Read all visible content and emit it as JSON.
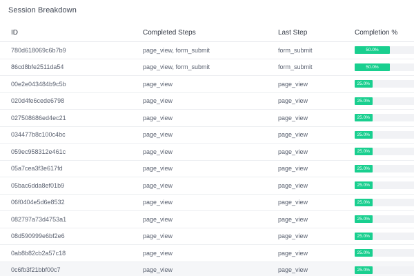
{
  "panel": {
    "title": "Session Breakdown"
  },
  "table": {
    "columns": [
      "ID",
      "Completed Steps",
      "Last Step",
      "Completion %"
    ],
    "rows": [
      {
        "id": "780d618069c6b7b9",
        "completed_steps": "page_view, form_submit",
        "last_step": "form_submit",
        "completion": 50.0,
        "completion_label": "50.0%"
      },
      {
        "id": "86cd8bfe2511da54",
        "completed_steps": "page_view, form_submit",
        "last_step": "form_submit",
        "completion": 50.0,
        "completion_label": "50.0%"
      },
      {
        "id": "00e2e043484b9c5b",
        "completed_steps": "page_view",
        "last_step": "page_view",
        "completion": 25.0,
        "completion_label": "25.0%"
      },
      {
        "id": "020d4fe6cede6798",
        "completed_steps": "page_view",
        "last_step": "page_view",
        "completion": 25.0,
        "completion_label": "25.0%"
      },
      {
        "id": "027508686ed4ec21",
        "completed_steps": "page_view",
        "last_step": "page_view",
        "completion": 25.0,
        "completion_label": "25.0%"
      },
      {
        "id": "034477b8c100c4bc",
        "completed_steps": "page_view",
        "last_step": "page_view",
        "completion": 25.0,
        "completion_label": "25.0%"
      },
      {
        "id": "059ec958312e461c",
        "completed_steps": "page_view",
        "last_step": "page_view",
        "completion": 25.0,
        "completion_label": "25.0%"
      },
      {
        "id": "05a7cea3f3e617fd",
        "completed_steps": "page_view",
        "last_step": "page_view",
        "completion": 25.0,
        "completion_label": "25.0%"
      },
      {
        "id": "05bac6dda8ef01b9",
        "completed_steps": "page_view",
        "last_step": "page_view",
        "completion": 25.0,
        "completion_label": "25.0%"
      },
      {
        "id": "06f0404e5d6e8532",
        "completed_steps": "page_view",
        "last_step": "page_view",
        "completion": 25.0,
        "completion_label": "25.0%"
      },
      {
        "id": "082797a73d4753a1",
        "completed_steps": "page_view",
        "last_step": "page_view",
        "completion": 25.0,
        "completion_label": "25.0%"
      },
      {
        "id": "08d590999e6bf2e6",
        "completed_steps": "page_view",
        "last_step": "page_view",
        "completion": 25.0,
        "completion_label": "25.0%"
      },
      {
        "id": "0ab8b82cb2a57c18",
        "completed_steps": "page_view",
        "last_step": "page_view",
        "completion": 25.0,
        "completion_label": "25.0%"
      },
      {
        "id": "0c6fb3f21bbf00c7",
        "completed_steps": "page_view",
        "last_step": "page_view",
        "completion": 25.0,
        "completion_label": "25.0%",
        "highlighted": true
      }
    ]
  },
  "colors": {
    "bar_fill": "#19cf8f",
    "bar_track": "#f1f2f5",
    "row_highlight": "#f5f6f8"
  }
}
